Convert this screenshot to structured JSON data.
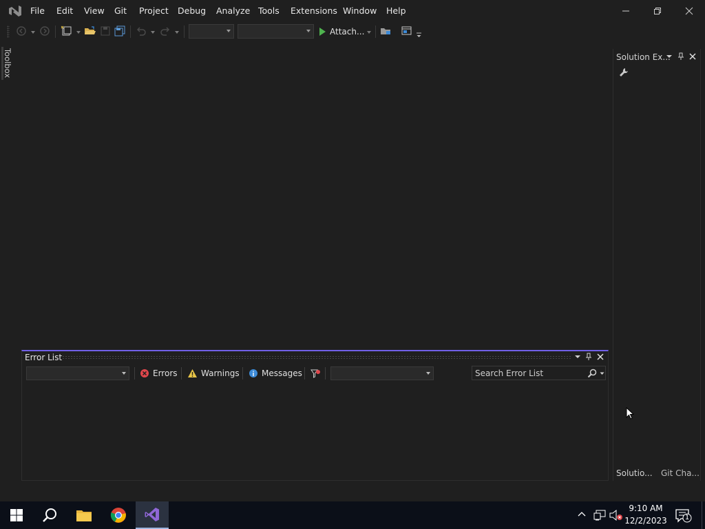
{
  "menu": {
    "items": [
      {
        "label": "File"
      },
      {
        "label": "Edit"
      },
      {
        "label": "View"
      },
      {
        "label": "Git"
      },
      {
        "label": "Project"
      },
      {
        "label": "Debug"
      },
      {
        "label": "Analyze"
      },
      {
        "label": "Tools"
      },
      {
        "label": "Extensions"
      },
      {
        "label": "Window"
      },
      {
        "label": "Help"
      }
    ]
  },
  "toolbar": {
    "attach_label": "Attach...",
    "solution_config_value": "",
    "solution_platform_value": ""
  },
  "toolbox": {
    "label": "Toolbox"
  },
  "solution_explorer": {
    "title": "Solution Ex...",
    "bottom_tabs": [
      {
        "label": "Solutio..."
      },
      {
        "label": "Git Cha..."
      }
    ]
  },
  "error_list": {
    "title": "Error List",
    "scope_value": "",
    "errors_label": "Errors",
    "warnings_label": "Warnings",
    "messages_label": "Messages",
    "build_filter_value": "",
    "search_placeholder": "Search Error List"
  },
  "taskbar": {
    "time": "9:10 AM",
    "date": "12/2/2023",
    "notification_count": "1"
  },
  "colors": {
    "background": "#1f1f1f",
    "accent": "#7160e8",
    "taskbar": "#0b0f18",
    "error_red": "#e0474c",
    "warning_yellow": "#e8c547",
    "info_blue": "#3d8bd8",
    "run_green": "#4fb34f"
  }
}
